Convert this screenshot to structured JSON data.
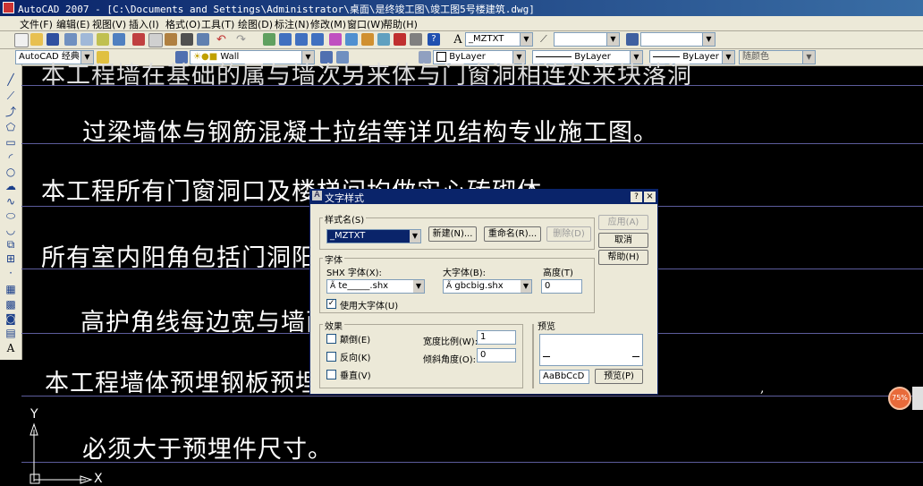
{
  "window": {
    "title": "AutoCAD 2007 - [C:\\Documents and Settings\\Administrator\\桌面\\是终竣工图\\竣工图5号楼建筑.dwg]"
  },
  "menu": [
    "文件(F)",
    "编辑(E)",
    "视图(V)",
    "插入(I)",
    "格式(O)",
    "工具(T)",
    "绘图(D)",
    "标注(N)",
    "修改(M)",
    "窗口(W)",
    "帮助(H)"
  ],
  "toolbar": {
    "text_style": "_MZTXT",
    "workspace": "AutoCAD 经典",
    "layer": "Wall",
    "color": "ByLayer",
    "linetype": "ByLayer",
    "lineweight": "ByLayer",
    "plotstyle": "随颜色"
  },
  "drawing": {
    "lines": [
      "本工程墙在基础的属与墙次另来体与门窗洞相连处来块落洞",
      "过梁墙体与钢筋混凝土拉结等详见结构专业施工图。",
      "本工程所有门窗洞口及楼梯间均做实心砖砌体",
      "所有室内阳角包括门洞阳角墙",
      "高护角线每边宽与墙面粉",
      "本工程墙体预埋钢板预埋件必",
      "必须大于预埋件尺寸。"
    ],
    "ucs_y": "Y",
    "ucs_x": "X",
    "comma": ","
  },
  "badge": {
    "percent": "75%"
  },
  "dialog": {
    "title": "文字样式",
    "style_group": "样式名(S)",
    "style_value": "_MZTXT",
    "new_btn": "新建(N)...",
    "rename_btn": "重命名(R)...",
    "delete_btn": "删除(D)",
    "apply_btn": "应用(A)",
    "cancel_btn": "取消",
    "help_btn": "帮助(H)",
    "font_group": "字体",
    "shx_label": "SHX 字体(X):",
    "shx_value": "te_____.shx",
    "big_label": "大字体(B):",
    "big_value": "gbcbig.shx",
    "height_label": "高度(T)",
    "height_value": "0",
    "use_big_label": "使用大字体(U)",
    "effects_group": "效果",
    "upside_label": "颠倒(E)",
    "backward_label": "反向(K)",
    "vertical_label": "垂直(V)",
    "width_label": "宽度比例(W):",
    "width_value": "1",
    "oblique_label": "倾斜角度(O):",
    "oblique_value": "0",
    "preview_group": "预览",
    "preview_text": "AaBbCcD",
    "preview_btn": "预览(P)",
    "help_q": "?",
    "close_x": "×"
  }
}
